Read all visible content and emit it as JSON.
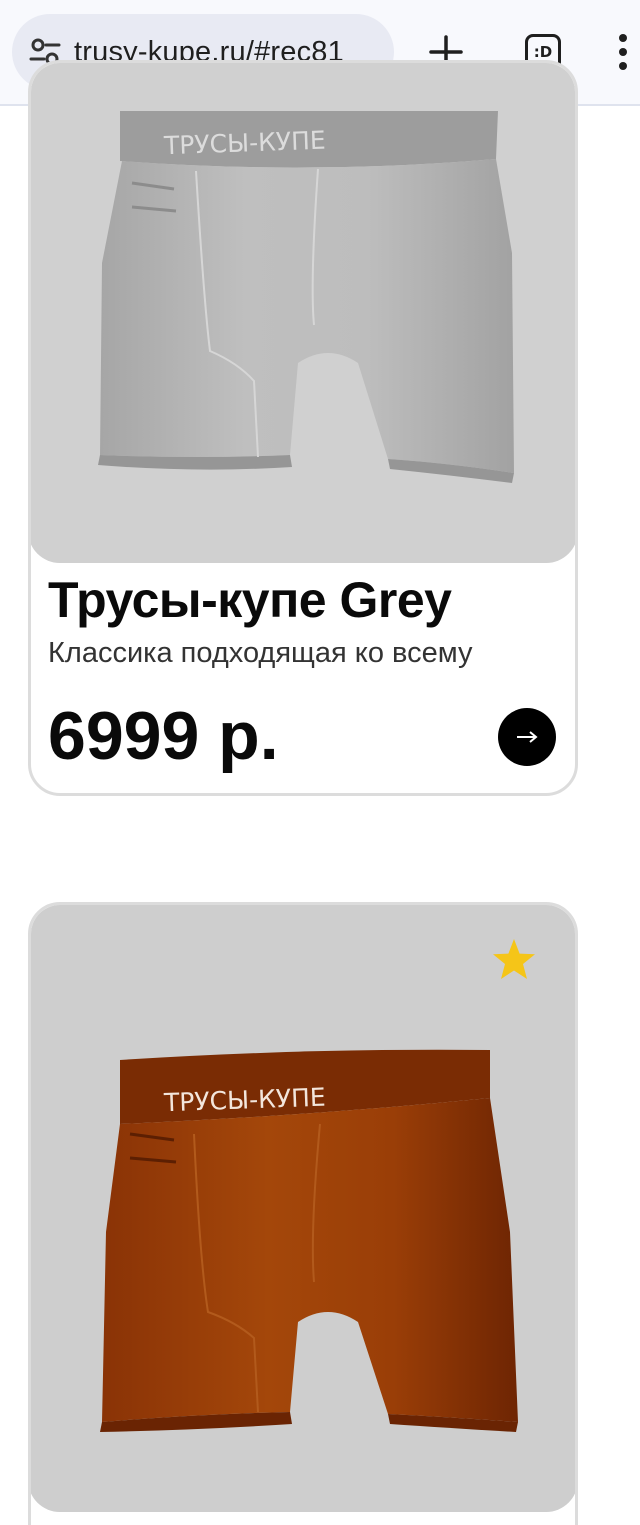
{
  "browser": {
    "url": "trusy-kupe.ru/#rec81",
    "new_tab_icon": "plus-icon",
    "tabs_icon": "tab-switcher-icon",
    "tabs_label": ":D",
    "menu_icon": "more-vert-icon",
    "site_info_icon": "site-settings-icon"
  },
  "products": [
    {
      "title": "Трусы-купе Grey",
      "description": "Классика подходящая ко всему",
      "price": "6999 р.",
      "brand_print": "ТРУСЫ-КУПЕ",
      "color": "#b9b9b9",
      "action_icon": "arrow-right-icon"
    },
    {
      "brand_print": "ТРУСЫ-КУПЕ",
      "color": "#9a3f06",
      "badge_icon": "star-icon",
      "badge_color": "#f5c518"
    }
  ]
}
